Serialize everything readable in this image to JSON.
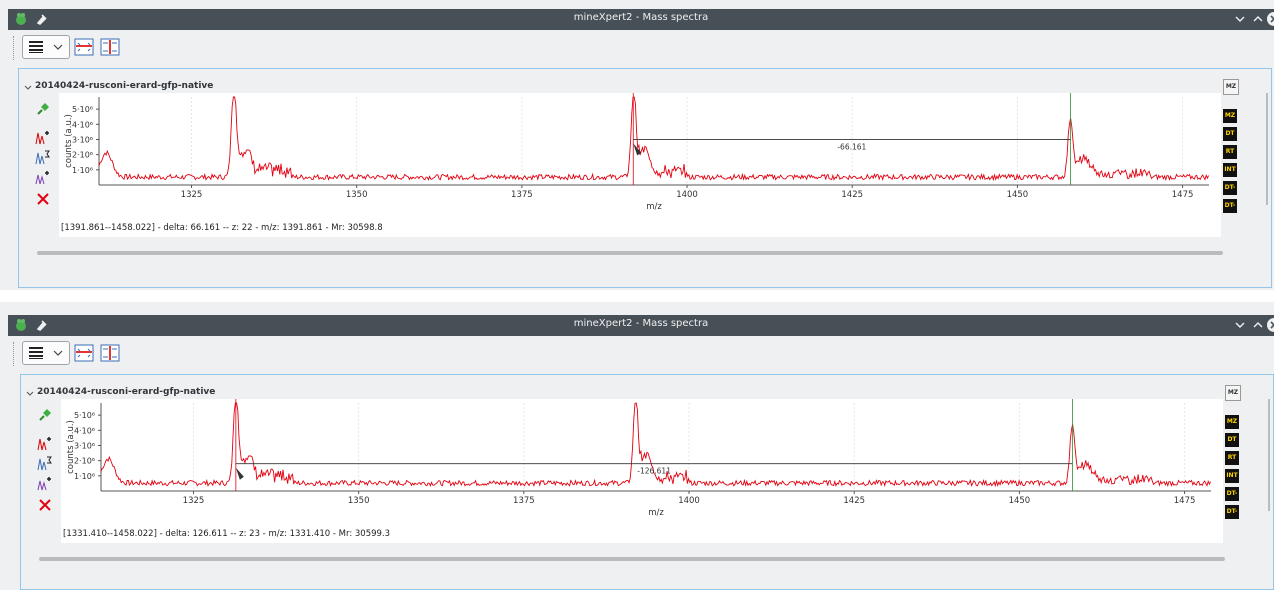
{
  "windows": [
    {
      "title": "mineXpert2 - Mass spectra",
      "panel_title": "20140424-rusconi-erard-gfp-native",
      "status": "[1391.861--1458.022] - delta: 66.161 -- z: 22 - m/z: 1391.861 - Mr: 30598.8",
      "measure_label": "-66.161",
      "measure_from": 1391.861,
      "measure_to": 1458.022,
      "measure_level": 3.0
    },
    {
      "title": "mineXpert2 - Mass spectra",
      "panel_title": "20140424-rusconi-erard-gfp-native",
      "status": "[1331.410--1458.022] - delta: 126.611 -- z: 23 - m/z: 1331.410 - Mr: 30599.3",
      "measure_label": "-126.611",
      "measure_from": 1331.41,
      "measure_to": 1458.022,
      "measure_level": 1.8
    }
  ],
  "axes": {
    "xlabel": "m/z",
    "ylabel": "counts (a.u.)",
    "xticks": [
      "1325",
      "1350",
      "1375",
      "1400",
      "1425",
      "1450",
      "1475"
    ],
    "yticks": [
      "1·10⁶",
      "2·10⁶",
      "3·10⁶",
      "4·10⁶",
      "5·10⁶"
    ]
  },
  "right_icons": [
    "MZ",
    "MZ",
    "DT",
    "RT",
    "INT",
    "DT-MZ",
    "DT-RT"
  ],
  "left_icons": [
    "pin-icon",
    "mass-spec-add-icon",
    "mass-spec-sum-icon",
    "mass-spec-combine-icon",
    "close-icon"
  ],
  "colors": {
    "trace": "#e3000f",
    "titlebar": "#475057",
    "frame": "#93c6e8",
    "marker": "#2e8b2e"
  },
  "chart_data": {
    "type": "line",
    "xlabel": "m/z",
    "ylabel": "counts (a.u.)",
    "xlim": [
      1311,
      1479
    ],
    "ylim": [
      0,
      5.8
    ],
    "y_unit_multiplier": "10^6",
    "peaks": [
      {
        "x": 1312.1,
        "y": 1.6
      },
      {
        "x": 1331.4,
        "y": 5.8
      },
      {
        "x": 1333.0,
        "y": 1.5
      },
      {
        "x": 1391.9,
        "y": 5.2
      },
      {
        "x": 1393.5,
        "y": 1.4
      },
      {
        "x": 1458.0,
        "y": 3.8
      },
      {
        "x": 1460.0,
        "y": 1.0
      }
    ],
    "baseline": 0.35
  }
}
